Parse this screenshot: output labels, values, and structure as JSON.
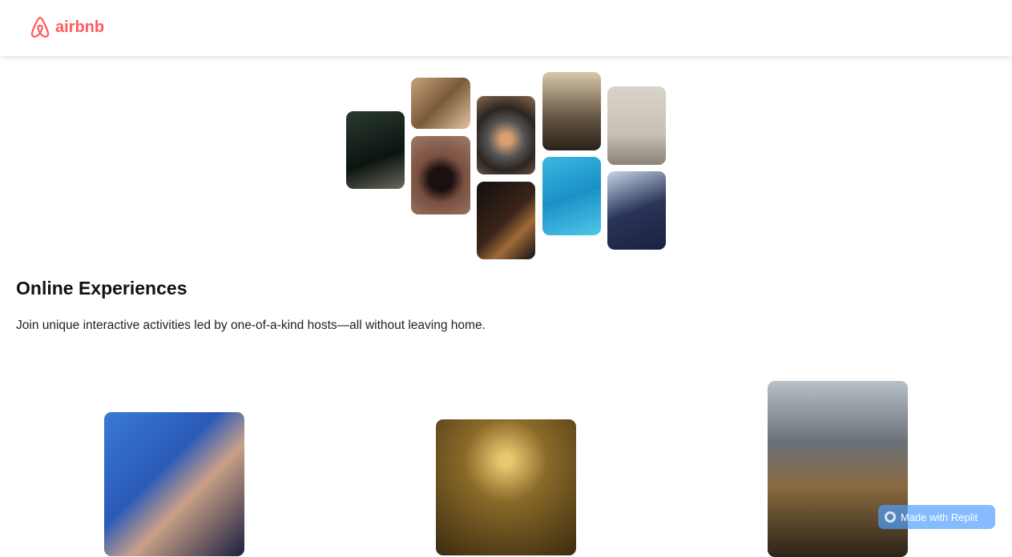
{
  "nav": {
    "logo_text": "airbnb"
  },
  "hero": {
    "photos": [
      "cooking-pan",
      "woman-portrait",
      "bowl-food",
      "microphone-piano",
      "yoga-meditation",
      "dancer-doorway",
      "guitar",
      "swimmer-pool",
      "singer-microphone"
    ]
  },
  "section": {
    "title": "Online Experiences",
    "subtitle": "Join unique interactive activities led by one-of-a-kind hosts—all without leaving home."
  },
  "cards": [
    "swimmer-athlete",
    "bride-hallway",
    "mountain-bike"
  ],
  "badge": {
    "label": "Made with Replit"
  },
  "colors": {
    "brand": "#ff5a5f"
  }
}
